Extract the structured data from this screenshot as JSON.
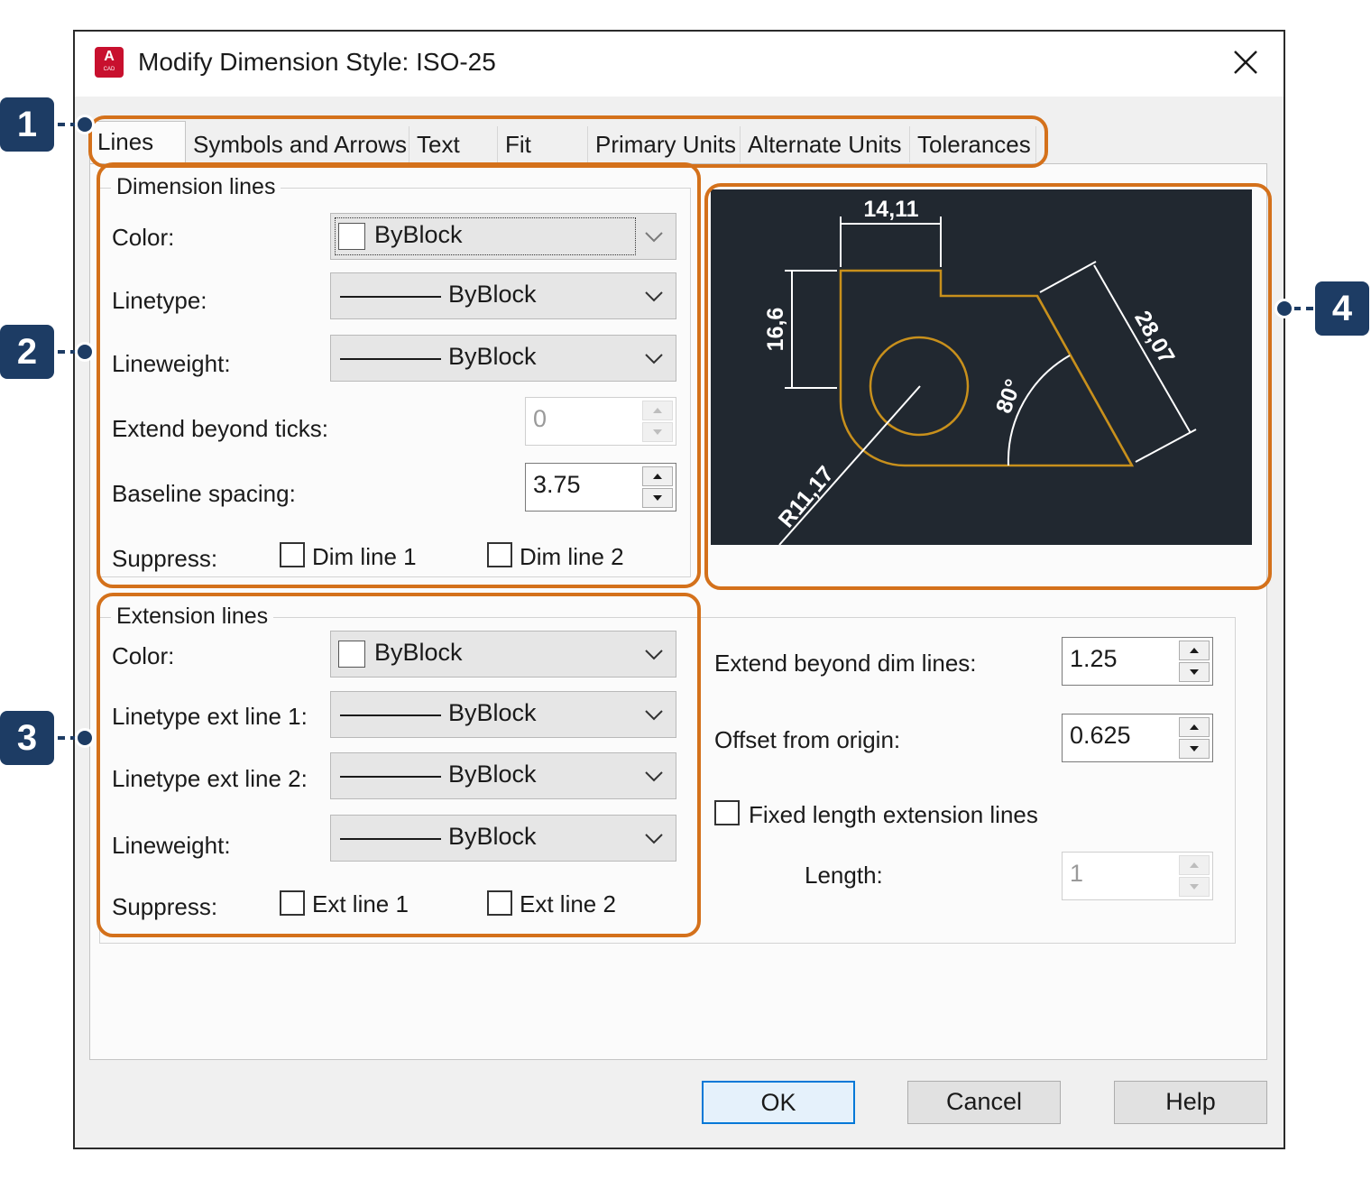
{
  "window": {
    "title": "Modify Dimension Style: ISO-25",
    "app_icon_letter": "A",
    "app_icon_caption": "CAD"
  },
  "tabs": [
    "Lines",
    "Symbols and Arrows",
    "Text",
    "Fit",
    "Primary Units",
    "Alternate Units",
    "Tolerances"
  ],
  "active_tab": "Lines",
  "dimension_lines": {
    "legend": "Dimension lines",
    "color_label": "Color:",
    "color_value": "ByBlock",
    "linetype_label": "Linetype:",
    "linetype_value": "ByBlock",
    "lineweight_label": "Lineweight:",
    "lineweight_value": "ByBlock",
    "extend_ticks_label": "Extend beyond ticks:",
    "extend_ticks_value": "0",
    "baseline_label": "Baseline spacing:",
    "baseline_value": "3.75",
    "suppress_label": "Suppress:",
    "suppress_1": "Dim line 1",
    "suppress_2": "Dim line 2"
  },
  "extension_lines": {
    "legend": "Extension lines",
    "color_label": "Color:",
    "color_value": "ByBlock",
    "linetype1_label": "Linetype ext line 1:",
    "linetype1_value": "ByBlock",
    "linetype2_label": "Linetype ext line 2:",
    "linetype2_value": "ByBlock",
    "lineweight_label": "Lineweight:",
    "lineweight_value": "ByBlock",
    "suppress_label": "Suppress:",
    "suppress_1": "Ext line 1",
    "suppress_2": "Ext line 2"
  },
  "right_settings": {
    "extend_dim_label": "Extend beyond dim lines:",
    "extend_dim_value": "1.25",
    "offset_label": "Offset from origin:",
    "offset_value": "0.625",
    "fixed_length_label": "Fixed length extension lines",
    "length_label": "Length:",
    "length_value": "1"
  },
  "preview": {
    "dim_top": "14,11",
    "dim_left": "16,6",
    "dim_diag": "28,07",
    "dim_angle": "80°",
    "dim_radius": "R11,17"
  },
  "buttons": {
    "ok": "OK",
    "cancel": "Cancel",
    "help": "Help"
  },
  "callouts": [
    "1",
    "2",
    "3",
    "4"
  ],
  "colors": {
    "highlight": "#d4711b",
    "badge": "#1d3c64",
    "preview_bg": "#212830",
    "preview_geometry": "#c8901c",
    "default_button_border": "#0078d7"
  }
}
